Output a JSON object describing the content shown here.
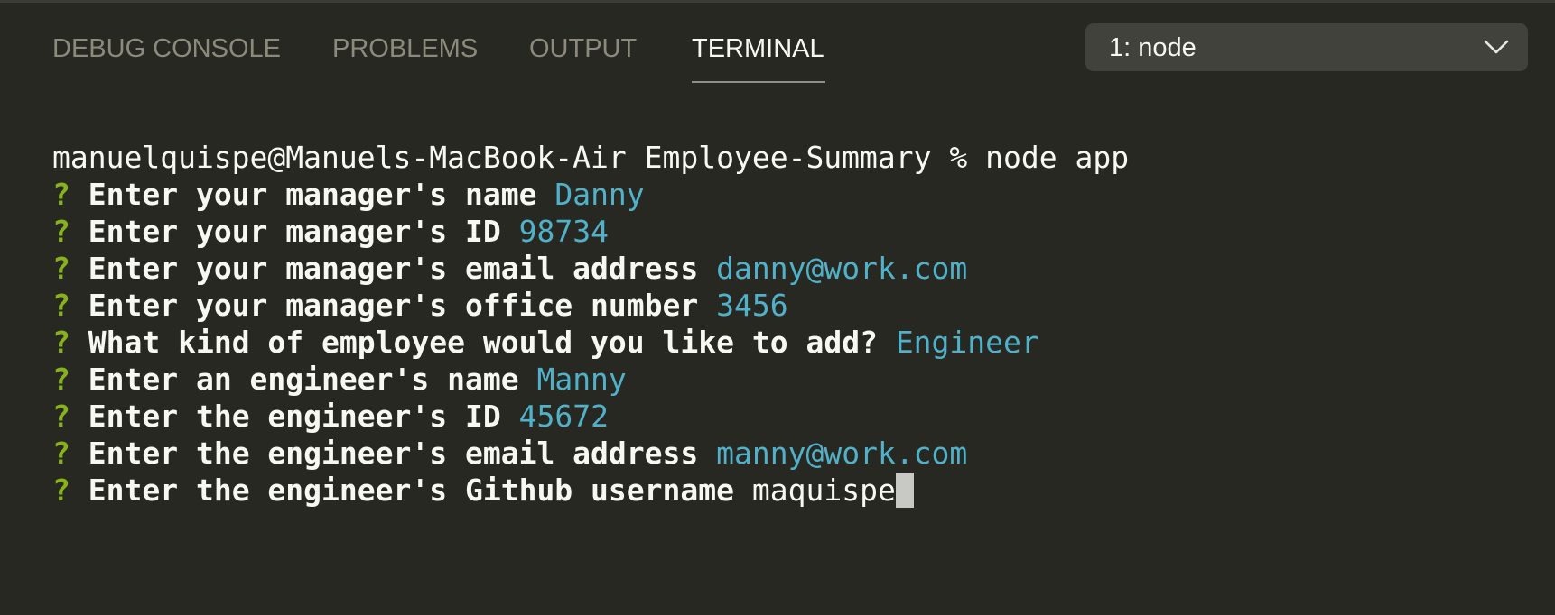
{
  "colors": {
    "background": "#272822",
    "tab_inactive": "#8c8a7c",
    "tab_active": "#f8f8f2",
    "question_mark": "#87b21e",
    "answer": "#51b1c9",
    "dropdown_bg": "#41423c"
  },
  "tabs": [
    {
      "label": "DEBUG CONSOLE",
      "active": false
    },
    {
      "label": "PROBLEMS",
      "active": false
    },
    {
      "label": "OUTPUT",
      "active": false
    },
    {
      "label": "TERMINAL",
      "active": true
    }
  ],
  "terminal_select": {
    "value": "1: node",
    "icon": "chevron-down-icon"
  },
  "terminal": {
    "command_line": "manuelquispe@Manuels-MacBook-Air Employee-Summary % node app",
    "prompts": [
      {
        "mark": "?",
        "question": "Enter your manager's name",
        "answer": "Danny"
      },
      {
        "mark": "?",
        "question": "Enter your manager's ID",
        "answer": "98734"
      },
      {
        "mark": "?",
        "question": "Enter your manager's email address",
        "answer": "danny@work.com"
      },
      {
        "mark": "?",
        "question": "Enter your manager's office number",
        "answer": "3456"
      },
      {
        "mark": "?",
        "question": "What kind of employee would you like to add?",
        "answer": "Engineer"
      },
      {
        "mark": "?",
        "question": "Enter an engineer's name",
        "answer": "Manny"
      },
      {
        "mark": "?",
        "question": "Enter the engineer's ID",
        "answer": "45672"
      },
      {
        "mark": "?",
        "question": "Enter the engineer's email address",
        "answer": "manny@work.com"
      }
    ],
    "active_prompt": {
      "mark": "?",
      "question": "Enter the engineer's Github username",
      "input": "maquispe"
    }
  }
}
